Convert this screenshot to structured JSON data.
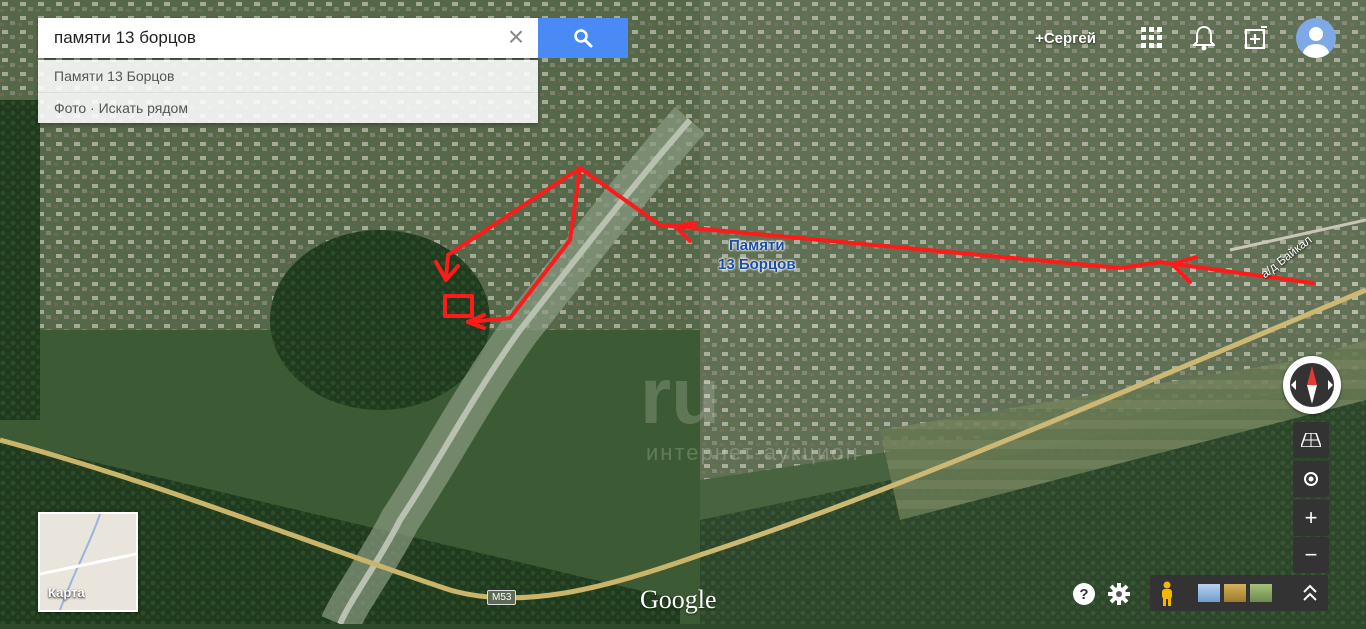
{
  "search": {
    "value": "памяти 13 борцов",
    "suggestions": [
      "Памяти 13 Борцов",
      "Фото · Искать рядом"
    ]
  },
  "topbar": {
    "user": "+Сергей"
  },
  "map": {
    "street_label_line1": "Памяти",
    "street_label_line2": "13 Борцов",
    "road_label": "а/д Байкал",
    "highway_shield": "M53",
    "watermark": "ru",
    "watermark_sub": "интернет-аукцион",
    "provider": "Google"
  },
  "minimap": {
    "label": "Карта"
  },
  "colors": {
    "accent": "#4a8af4",
    "arrow": "#ff1a1a",
    "label": "#1a4da8"
  }
}
